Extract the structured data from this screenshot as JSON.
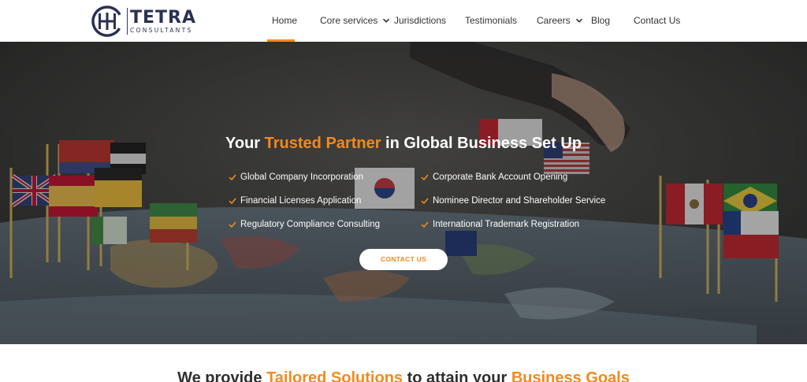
{
  "brand": {
    "name": "TETRA",
    "tagline": "CONSULTANTS",
    "navy": "#2b3152",
    "accent": "#f28a1b"
  },
  "nav": {
    "items": [
      {
        "label": "Home",
        "active": true,
        "dropdown": false
      },
      {
        "label": "Core services",
        "active": false,
        "dropdown": true
      },
      {
        "label": "Jurisdictions",
        "active": false,
        "dropdown": false
      },
      {
        "label": "Testimonials",
        "active": false,
        "dropdown": false
      },
      {
        "label": "Careers",
        "active": false,
        "dropdown": true
      },
      {
        "label": "Blog",
        "active": false,
        "dropdown": false
      },
      {
        "label": "Contact Us",
        "active": false,
        "dropdown": false
      }
    ]
  },
  "hero": {
    "title_pre": "Your ",
    "title_highlight": "Trusted Partner",
    "title_post": " in Global Business Set Up",
    "features_left": [
      "Global Company Incorporation",
      "Financial Licenses Application",
      "Regulatory Compliance Consulting"
    ],
    "features_right": [
      "Corporate Bank Account Opening",
      "Nominee Director and Shareholder Service",
      "International Trademark Registration"
    ],
    "cta_label": "CONTACT US",
    "icons": {
      "feature": "check-icon",
      "nav_dropdown": "chevron-down-icon"
    }
  },
  "section": {
    "pre": "We provide ",
    "hl1": "Tailored Solutions",
    "mid": " to attain your ",
    "hl2": "Business Goals"
  }
}
